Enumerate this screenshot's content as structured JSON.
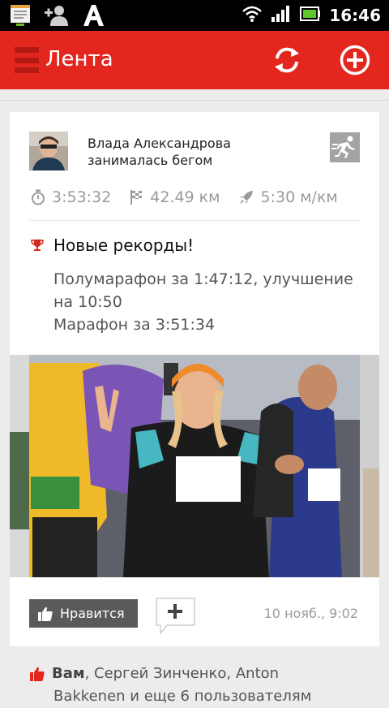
{
  "status_bar": {
    "time": "16:46",
    "icons": [
      "notification-icon",
      "add-contact-icon",
      "font-app-icon",
      "wifi-icon",
      "signal-icon",
      "battery-icon"
    ]
  },
  "action_bar": {
    "title": "Лента",
    "icons": [
      "menu-icon",
      "refresh-icon",
      "add-circle-icon"
    ],
    "accent": "#e3261e"
  },
  "post": {
    "user_name": "Влада Александрова",
    "activity": "занималась бегом",
    "stats": {
      "duration": "3:53:32",
      "distance": "42.49 км",
      "pace": "5:30 м/км"
    },
    "records_title": "Новые рекорды!",
    "records": [
      "Полумарафон за 1:47:12, улучшение на 10:50",
      "Марафон за 3:51:34"
    ],
    "like_label": "Нравится",
    "date": "10 нояб., 9:02"
  },
  "likers": {
    "bold": "Вам",
    "rest": ", Сергей Зинченко, Anton",
    "second_line": "Bakkenen и еще 6 пользователям"
  }
}
